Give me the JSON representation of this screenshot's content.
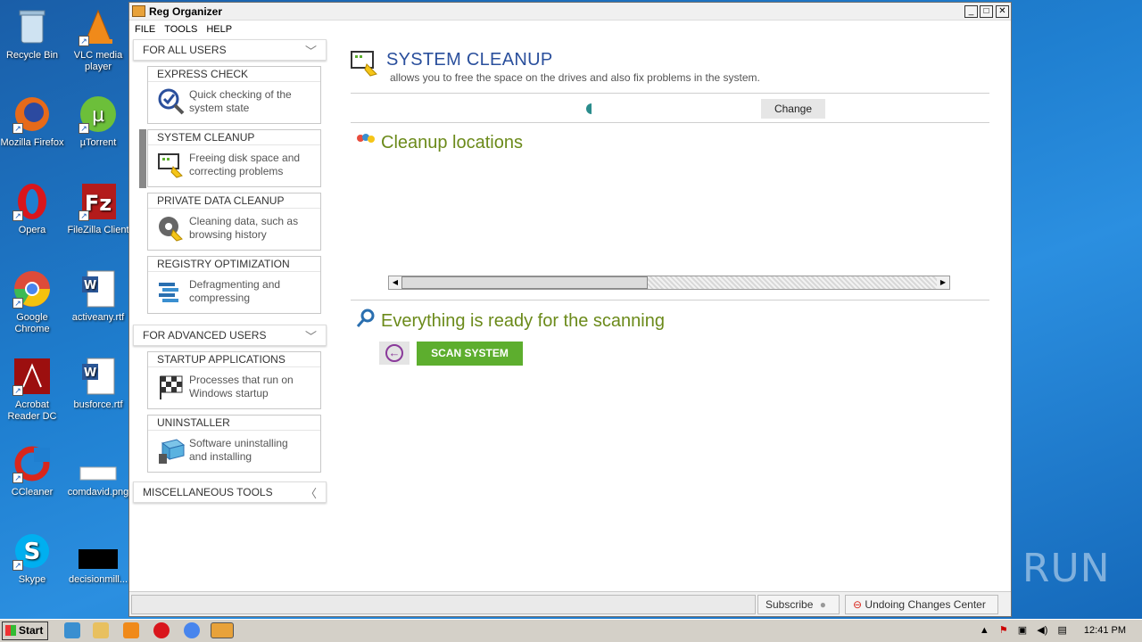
{
  "desktop": {
    "icons": [
      {
        "label": "Recycle Bin"
      },
      {
        "label": "VLC media player"
      },
      {
        "label": "Mozilla Firefox"
      },
      {
        "label": "µTorrent"
      },
      {
        "label": "Opera"
      },
      {
        "label": "FileZilla Client"
      },
      {
        "label": "Google Chrome"
      },
      {
        "label": "activeany.rtf"
      },
      {
        "label": "Acrobat Reader DC"
      },
      {
        "label": "busforce.rtf"
      },
      {
        "label": "CCleaner"
      },
      {
        "label": "comdavid.png"
      },
      {
        "label": "Skype"
      },
      {
        "label": "decisionmill..."
      }
    ]
  },
  "window": {
    "title": "Reg Organizer",
    "controls": {
      "minimize": "_",
      "maximize": "□",
      "close": "✕"
    }
  },
  "menu": {
    "file": "FILE",
    "tools": "TOOLS",
    "help": "HELP"
  },
  "sidebar": {
    "for_all_users": "FOR ALL USERS",
    "for_advanced_users": "FOR ADVANCED USERS",
    "misc_tools": "MISCELLANEOUS TOOLS",
    "cards": [
      {
        "title": "EXPRESS CHECK",
        "desc1": "Quick checking of the",
        "desc2": "system state"
      },
      {
        "title": "SYSTEM CLEANUP",
        "desc1": "Freeing disk space and",
        "desc2": "correcting problems"
      },
      {
        "title": "PRIVATE DATA CLEANUP",
        "desc1": "Cleaning data, such as",
        "desc2": "browsing history"
      },
      {
        "title": "REGISTRY OPTIMIZATION",
        "desc1": "Defragmenting and",
        "desc2": "compressing"
      },
      {
        "title": "STARTUP APPLICATIONS",
        "desc1": "Processes that run on",
        "desc2": "Windows startup"
      },
      {
        "title": "UNINSTALLER",
        "desc1": "Software uninstalling",
        "desc2": "and installing"
      }
    ]
  },
  "main": {
    "title": "SYSTEM CLEANUP",
    "subtitle": "allows you to free the space on the drives and also fix problems in the system.",
    "change_label": "Change",
    "cleanup_locations": "Cleanup locations",
    "ready_text": "Everything is ready for the scanning",
    "scan_label": "SCAN SYSTEM"
  },
  "statusbar": {
    "subscribe": "Subscribe",
    "undo_center": "Undoing Changes Center"
  },
  "taskbar": {
    "start": "Start",
    "time": "12:41 PM"
  },
  "watermark": "ANY RUN",
  "colors": {
    "accent_blue": "#2a4f9c",
    "section_green": "#6b8a1a",
    "scan_green": "#5dae2e"
  }
}
